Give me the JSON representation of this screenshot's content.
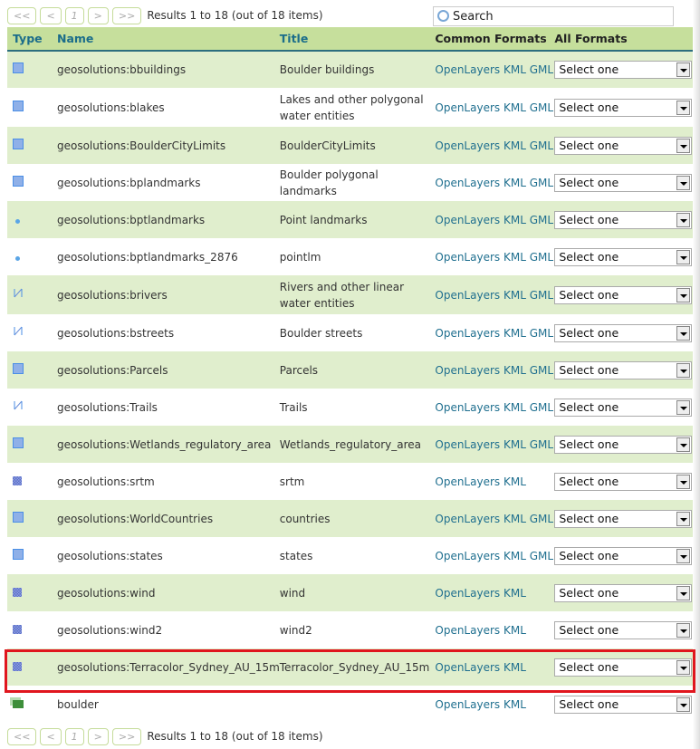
{
  "pager": {
    "first": "<<",
    "prev": "<",
    "page": "1",
    "next": ">",
    "last": ">>",
    "summary": "Results 1 to 18 (out of 18 items)"
  },
  "search": {
    "placeholder": "Search"
  },
  "columns": {
    "type": "Type",
    "name": "Name",
    "title": "Title",
    "common": "Common Formats",
    "all": "All Formats"
  },
  "rows": [
    {
      "type": "polygon",
      "name": "geosolutions:bbuildings",
      "title": "Boulder buildings",
      "formats": [
        "OpenLayers",
        "KML",
        "GML"
      ],
      "select": "Select one"
    },
    {
      "type": "polygon",
      "name": "geosolutions:blakes",
      "title": "Lakes and other polygonal water entities",
      "formats": [
        "OpenLayers",
        "KML",
        "GML"
      ],
      "select": "Select one"
    },
    {
      "type": "polygon",
      "name": "geosolutions:BoulderCityLimits",
      "title": "BoulderCityLimits",
      "formats": [
        "OpenLayers",
        "KML",
        "GML"
      ],
      "select": "Select one"
    },
    {
      "type": "polygon",
      "name": "geosolutions:bplandmarks",
      "title": "Boulder polygonal landmarks",
      "formats": [
        "OpenLayers",
        "KML",
        "GML"
      ],
      "select": "Select one"
    },
    {
      "type": "point",
      "name": "geosolutions:bptlandmarks",
      "title": "Point landmarks",
      "formats": [
        "OpenLayers",
        "KML",
        "GML"
      ],
      "select": "Select one"
    },
    {
      "type": "point",
      "name": "geosolutions:bptlandmarks_2876",
      "title": "pointlm",
      "formats": [
        "OpenLayers",
        "KML",
        "GML"
      ],
      "select": "Select one"
    },
    {
      "type": "line",
      "name": "geosolutions:brivers",
      "title": "Rivers and other linear water entities",
      "formats": [
        "OpenLayers",
        "KML",
        "GML"
      ],
      "select": "Select one"
    },
    {
      "type": "line",
      "name": "geosolutions:bstreets",
      "title": "Boulder streets",
      "formats": [
        "OpenLayers",
        "KML",
        "GML"
      ],
      "select": "Select one"
    },
    {
      "type": "polygon",
      "name": "geosolutions:Parcels",
      "title": "Parcels",
      "formats": [
        "OpenLayers",
        "KML",
        "GML"
      ],
      "select": "Select one"
    },
    {
      "type": "line",
      "name": "geosolutions:Trails",
      "title": "Trails",
      "formats": [
        "OpenLayers",
        "KML",
        "GML"
      ],
      "select": "Select one"
    },
    {
      "type": "polygon",
      "name": "geosolutions:Wetlands_regulatory_area",
      "title": "Wetlands_regulatory_area",
      "formats": [
        "OpenLayers",
        "KML",
        "GML"
      ],
      "select": "Select one"
    },
    {
      "type": "raster",
      "name": "geosolutions:srtm",
      "title": "srtm",
      "formats": [
        "OpenLayers",
        "KML"
      ],
      "select": "Select one"
    },
    {
      "type": "polygon",
      "name": "geosolutions:WorldCountries",
      "title": "countries",
      "formats": [
        "OpenLayers",
        "KML",
        "GML"
      ],
      "select": "Select one"
    },
    {
      "type": "polygon",
      "name": "geosolutions:states",
      "title": "states",
      "formats": [
        "OpenLayers",
        "KML",
        "GML"
      ],
      "select": "Select one"
    },
    {
      "type": "raster",
      "name": "geosolutions:wind",
      "title": "wind",
      "formats": [
        "OpenLayers",
        "KML"
      ],
      "select": "Select one"
    },
    {
      "type": "raster",
      "name": "geosolutions:wind2",
      "title": "wind2",
      "formats": [
        "OpenLayers",
        "KML"
      ],
      "select": "Select one"
    },
    {
      "type": "raster",
      "name": "geosolutions:Terracolor_Sydney_AU_15m",
      "title": "Terracolor_Sydney_AU_15m",
      "formats": [
        "OpenLayers",
        "KML"
      ],
      "select": "Select one",
      "highlighted": true
    },
    {
      "type": "group",
      "name": "boulder",
      "title": "",
      "formats": [
        "OpenLayers",
        "KML"
      ],
      "select": "Select one"
    }
  ],
  "colors": {
    "header": "#c6df9c",
    "row_alt": "#e0eecd",
    "link": "#1f6f8f",
    "highlight": "#e0161e"
  }
}
